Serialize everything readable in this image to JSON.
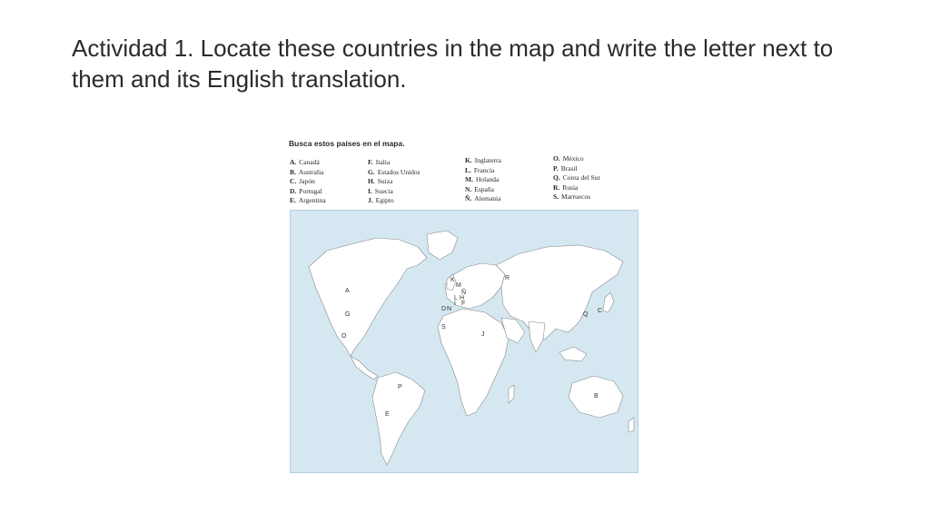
{
  "slide": {
    "title": "Actividad 1. Locate these countries in the map and write the letter next to them and its English translation."
  },
  "worksheet": {
    "heading": "Busca estos países en el mapa.",
    "columns": [
      [
        {
          "letter": "A.",
          "name": "Canadá"
        },
        {
          "letter": "B.",
          "name": "Australia"
        },
        {
          "letter": "C.",
          "name": "Japón"
        },
        {
          "letter": "D.",
          "name": "Portugal"
        },
        {
          "letter": "E.",
          "name": "Argentina"
        }
      ],
      [
        {
          "letter": "F.",
          "name": "Italia"
        },
        {
          "letter": "G.",
          "name": "Estados Unidos"
        },
        {
          "letter": "H.",
          "name": "Suiza"
        },
        {
          "letter": "I.",
          "name": "Suecia"
        },
        {
          "letter": "J.",
          "name": "Egipto"
        }
      ],
      [
        {
          "letter": "K.",
          "name": "Inglaterra"
        },
        {
          "letter": "L.",
          "name": "Francia"
        },
        {
          "letter": "M.",
          "name": "Holanda"
        },
        {
          "letter": "N.",
          "name": "España"
        },
        {
          "letter": "Ñ.",
          "name": "Alemania"
        }
      ],
      [
        {
          "letter": "O.",
          "name": "México"
        },
        {
          "letter": "P.",
          "name": "Brasil"
        },
        {
          "letter": "Q.",
          "name": "Corea del Sur"
        },
        {
          "letter": "R.",
          "name": "Rusia"
        },
        {
          "letter": "S.",
          "name": "Marruecos"
        }
      ]
    ]
  },
  "map": {
    "labels": [
      "A",
      "G",
      "O",
      "P",
      "E",
      "R",
      "M",
      "Ñ",
      "L",
      "H",
      "D",
      "N",
      "I",
      "S",
      "J",
      "C",
      "Q",
      "B",
      "K",
      "F"
    ],
    "colors": {
      "ocean": "#d5e8f2",
      "land": "#ffffff",
      "border": "#8a8a8a"
    }
  }
}
